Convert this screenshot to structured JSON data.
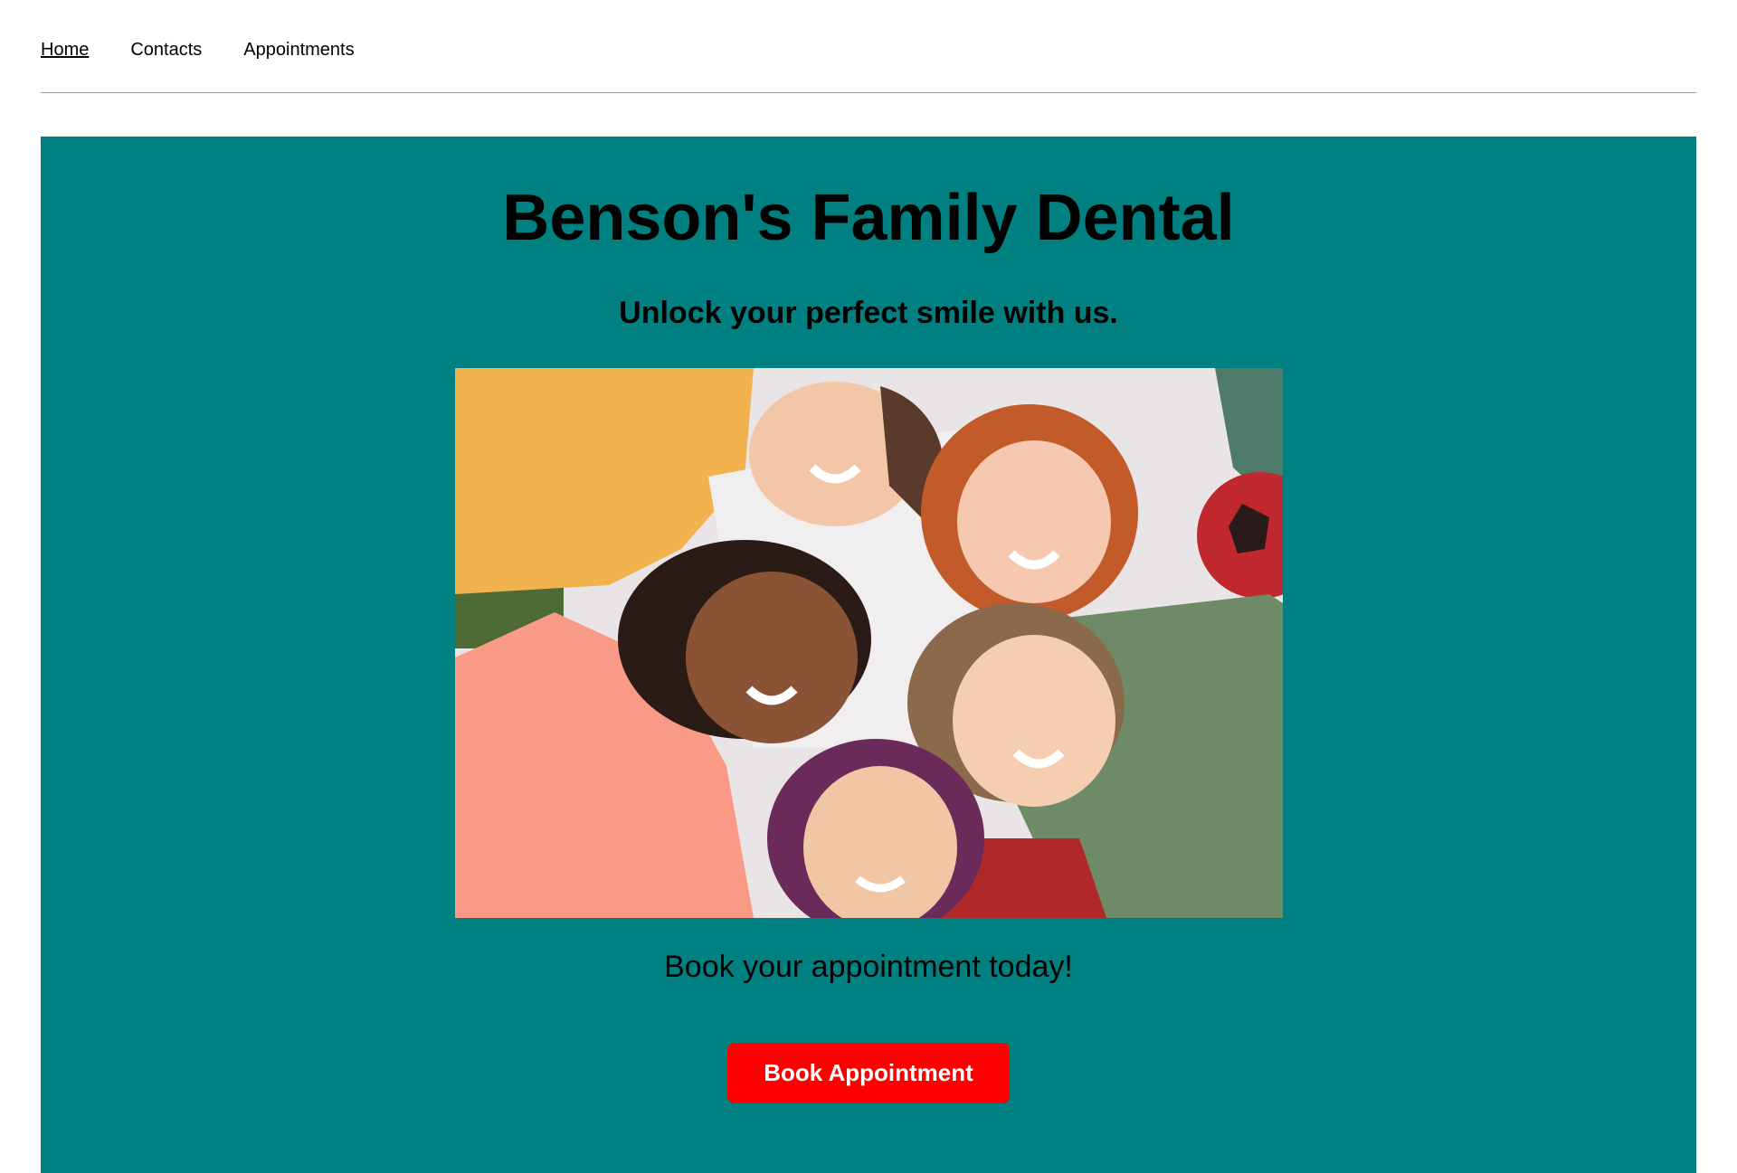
{
  "nav": {
    "items": [
      {
        "label": "Home",
        "active": true
      },
      {
        "label": "Contacts",
        "active": false
      },
      {
        "label": "Appointments",
        "active": false
      }
    ]
  },
  "hero": {
    "title": "Benson's Family Dental",
    "subtitle": "Unlock your perfect smile with us.",
    "cta_text": "Book your appointment today!",
    "button_label": "Book Appointment",
    "colors": {
      "background": "#008080",
      "button": "#ff0000",
      "button_text": "#ffffff"
    }
  }
}
